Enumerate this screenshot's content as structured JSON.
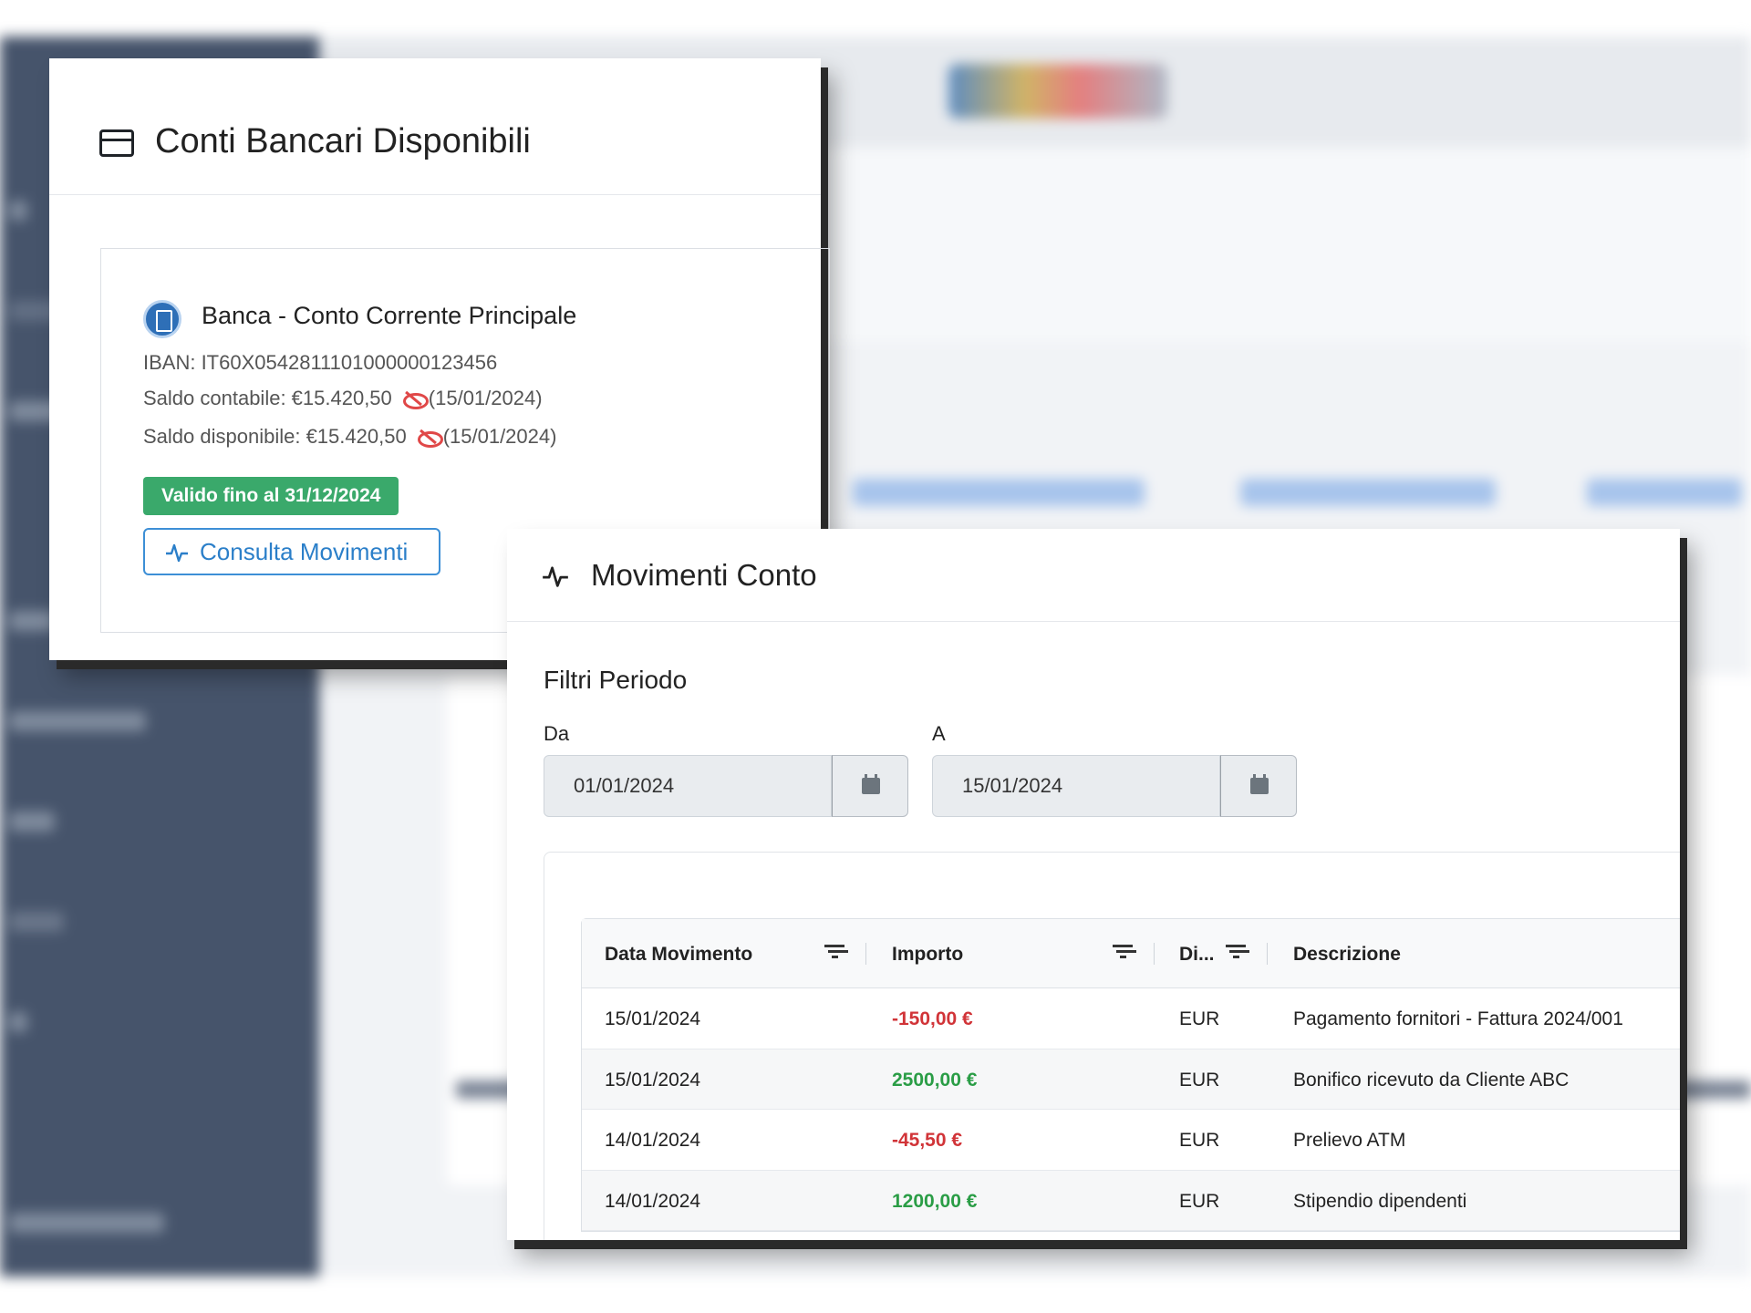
{
  "accounts_panel": {
    "title": "Conti Bancari Disponibili",
    "account": {
      "name": "Banca - Conto Corrente Principale",
      "iban": "IBAN: IT60X0542811101000000123456",
      "balance_book_label": "Saldo contabile: €15.420,50",
      "balance_book_date": "(15/01/2024)",
      "balance_available_label": "Saldo disponibile: €15.420,50",
      "balance_available_date": "(15/01/2024)",
      "validity_badge": "Valido fino al 31/12/2024",
      "consult_button": "Consulta Movimenti"
    }
  },
  "movements_panel": {
    "title": "Movimenti Conto",
    "filters_title": "Filtri Periodo",
    "from_label": "Da",
    "from_value": "01/01/2024",
    "to_label": "A",
    "to_value": "15/01/2024",
    "columns": [
      "Data Movimento",
      "Importo",
      "Di...",
      "Descrizione"
    ],
    "rows": [
      {
        "date": "15/01/2024",
        "amount": "-150,00 €",
        "sign": "neg",
        "currency": "EUR",
        "description": "Pagamento fornitori - Fattura 2024/001"
      },
      {
        "date": "15/01/2024",
        "amount": "2500,00 €",
        "sign": "pos",
        "currency": "EUR",
        "description": "Bonifico ricevuto da Cliente ABC"
      },
      {
        "date": "14/01/2024",
        "amount": "-45,50 €",
        "sign": "neg",
        "currency": "EUR",
        "description": "Prelievo ATM"
      },
      {
        "date": "14/01/2024",
        "amount": "1200,00 €",
        "sign": "pos",
        "currency": "EUR",
        "description": "Stipendio dipendenti"
      }
    ]
  },
  "colors": {
    "positive_amount": "#2a9d46",
    "negative_amount": "#d13438",
    "badge_green": "#3aa96b",
    "accent_blue": "#2b7fc9"
  },
  "icons": [
    "credit-card-icon",
    "bank-logo-icon",
    "eye-off-icon",
    "activity-icon",
    "calendar-icon",
    "filter-icon"
  ]
}
